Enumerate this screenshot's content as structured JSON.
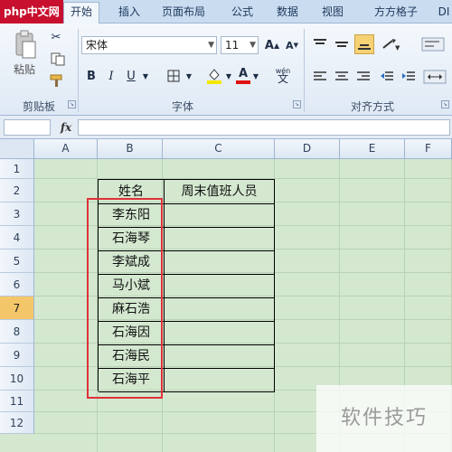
{
  "tabs": {
    "logo": "php中文网",
    "start": "开始",
    "insert": "插入",
    "page_layout": "页面布局",
    "formulas": "公式",
    "data": "数据",
    "view": "视图",
    "fangfang": "方方格子",
    "di": "DI"
  },
  "ribbon": {
    "clipboard": {
      "paste": "粘贴",
      "label": "剪贴板"
    },
    "font": {
      "name": "宋体",
      "size": "11",
      "bold": "B",
      "italic": "I",
      "underline": "U",
      "label": "字体",
      "wen": "wén",
      "grow": "A",
      "shrink": "A"
    },
    "alignment": {
      "label": "对齐方式"
    }
  },
  "formula_bar": {
    "fx": "fx",
    "name_box": "",
    "content": ""
  },
  "columns": [
    "A",
    "B",
    "C",
    "D",
    "E",
    "F"
  ],
  "rows": [
    "1",
    "2",
    "3",
    "4",
    "5",
    "6",
    "7",
    "8",
    "9",
    "10",
    "11",
    "12"
  ],
  "table": {
    "header_name": "姓名",
    "header_duty": "周末值班人员",
    "names": [
      "李东阳",
      "石海琴",
      "李斌成",
      "马小斌",
      "麻石浩",
      "石海因",
      "石海民",
      "石海平"
    ]
  },
  "watermark": "软件技巧",
  "selected_row": "7"
}
